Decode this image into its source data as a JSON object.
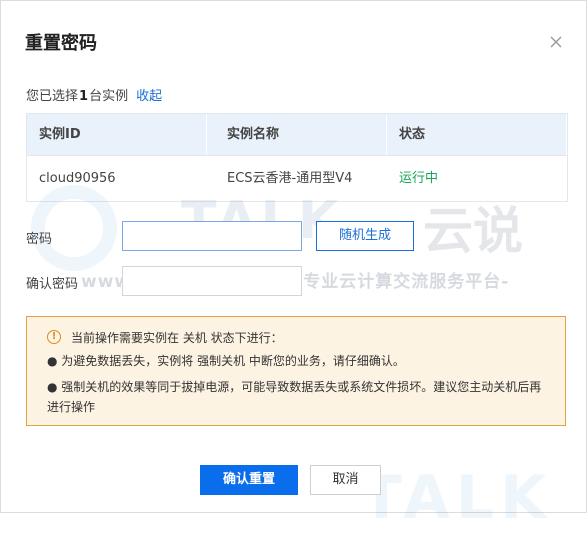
{
  "dialog": {
    "title": "重置密码",
    "close_icon": "close-icon"
  },
  "selection": {
    "prefix": "您已选择",
    "count": "1",
    "suffix": "台实例",
    "collapse_link": "收起"
  },
  "table": {
    "headers": [
      "实例ID",
      "实例名称",
      "状态"
    ],
    "rows": [
      {
        "id": "cloud90956",
        "name": "ECS云香港-通用型V4",
        "status": "运行中"
      }
    ]
  },
  "form": {
    "password_label": "密码",
    "password_value": "",
    "confirm_label": "确认密码",
    "confirm_value": "",
    "generate_button": "随机生成"
  },
  "notice": {
    "icon": "warning-icon",
    "head": "当前操作需要实例在 关机 状态下进行：",
    "line1": "● 为避免数据丢失，实例将 强制关机 中断您的业务，请仔细确认。",
    "line2": "● 强制关机的效果等同于拔掉电源，可能导致数据丢失或系统文件损坏。建议您主动关机后再进行操作"
  },
  "actions": {
    "confirm": "确认重置",
    "cancel": "取消"
  },
  "watermark": {
    "logo_text": "TALK",
    "logo_cn": "云说",
    "url_line": "www.idctalk.com-国内专业云计算交流服务平台-"
  },
  "colors": {
    "primary": "#0a6dec",
    "link": "#1a6fd8",
    "status_running": "#19a657",
    "notice_border": "#e0a245",
    "notice_bg": "#fdf3e3"
  }
}
